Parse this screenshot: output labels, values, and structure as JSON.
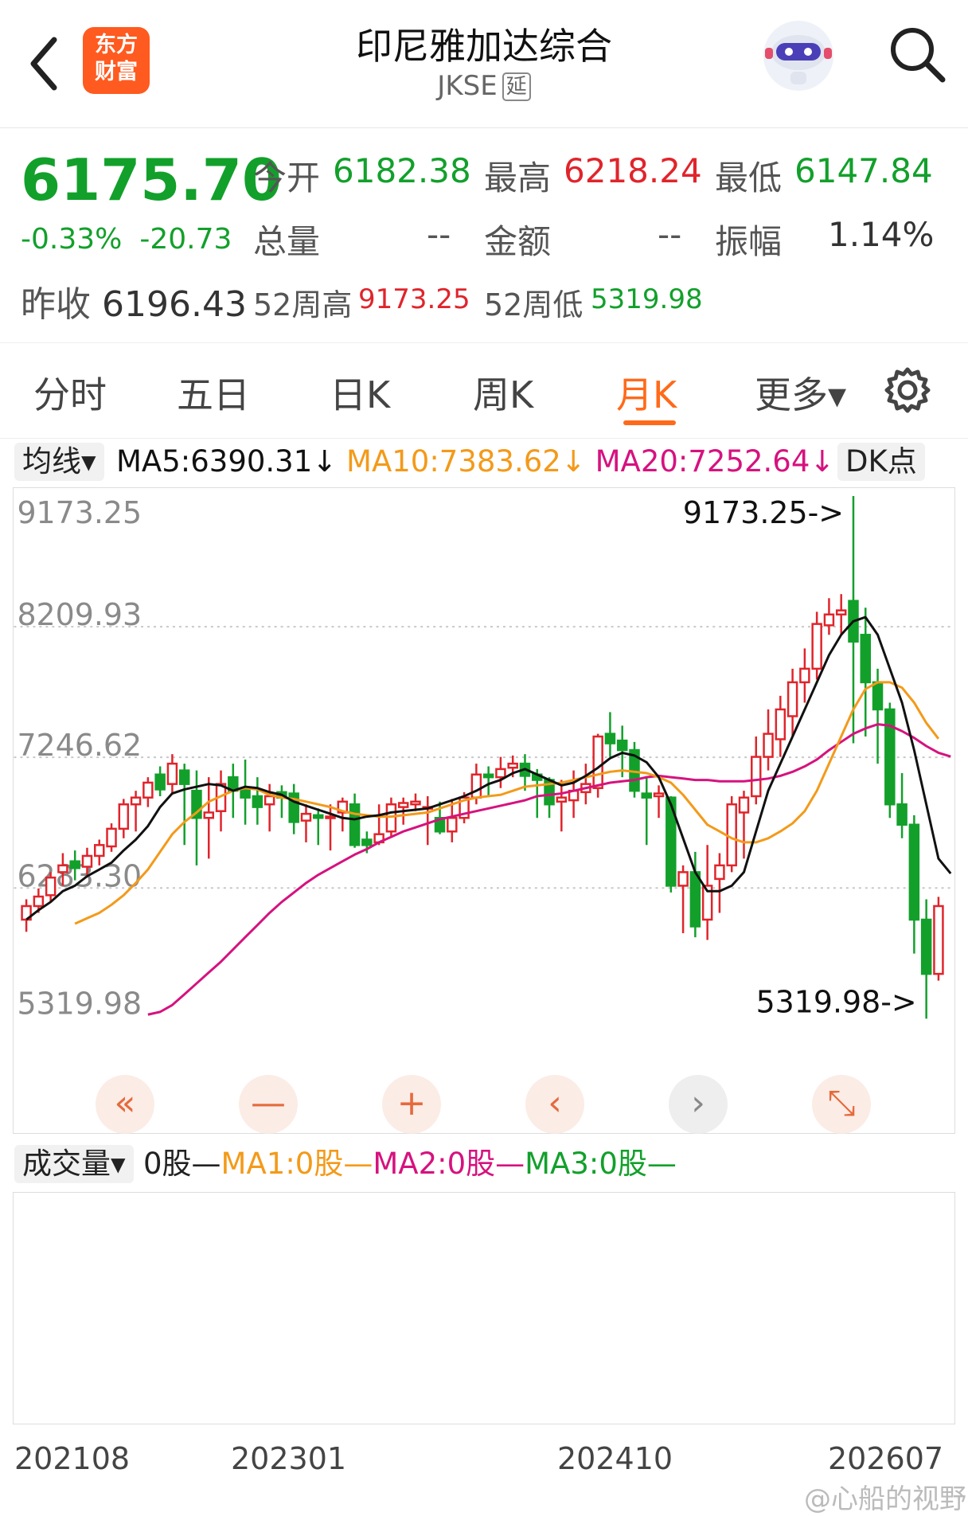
{
  "header": {
    "title": "印尼雅加达综合",
    "code": "JKSE",
    "delay_badge": "延",
    "logo_line1": "东方",
    "logo_line2": "财富"
  },
  "quote": {
    "price": "6175.70",
    "change_pct": "-0.33%",
    "change": "-20.73",
    "prev_close_label": "昨收",
    "prev_close": "6196.43",
    "open_label": "今开",
    "open": "6182.38",
    "high_label": "最高",
    "high": "6218.24",
    "low_label": "最低",
    "low": "6147.84",
    "volume_label": "总量",
    "volume": "--",
    "amount_label": "金额",
    "amount": "--",
    "amplitude_label": "振幅",
    "amplitude": "1.14%",
    "w52_high_label": "52周高",
    "w52_high": "9173.25",
    "w52_low_label": "52周低",
    "w52_low": "5319.98"
  },
  "tabs": [
    {
      "label": "分时",
      "active": false
    },
    {
      "label": "五日",
      "active": false
    },
    {
      "label": "日K",
      "active": false
    },
    {
      "label": "周K",
      "active": false
    },
    {
      "label": "月K",
      "active": true
    },
    {
      "label": "更多▾",
      "active": false
    }
  ],
  "ma_legend": {
    "selector": "均线▾",
    "ma5": "MA5:6390.31↓",
    "ma10": "MA10:7383.62↓",
    "ma20": "MA20:7252.64↓",
    "dk_button": "DK点"
  },
  "colors": {
    "up": "#e0242b",
    "down": "#12a02b",
    "ma5": "#111111",
    "ma10": "#f39a1a",
    "ma20": "#d6127e",
    "accent": "#ff6a1a"
  },
  "chart_data": {
    "type": "candlestick",
    "y_ticks": [
      "9173.25",
      "8209.93",
      "7246.62",
      "6283.30",
      "5319.98"
    ],
    "ylim": [
      5319.98,
      9173.25
    ],
    "max_label": "9173.25->",
    "min_label": "5319.98->",
    "x_labels": [
      "202108",
      "202301",
      "202410",
      "202607"
    ],
    "candles": [
      [
        6050,
        6150,
        5960,
        6200
      ],
      [
        6150,
        6220,
        6100,
        6280
      ],
      [
        6230,
        6360,
        6180,
        6400
      ],
      [
        6400,
        6450,
        6300,
        6540
      ],
      [
        6480,
        6430,
        6340,
        6560
      ],
      [
        6440,
        6520,
        6380,
        6580
      ],
      [
        6520,
        6600,
        6450,
        6640
      ],
      [
        6590,
        6720,
        6550,
        6760
      ],
      [
        6720,
        6900,
        6650,
        6940
      ],
      [
        6900,
        6950,
        6700,
        7000
      ],
      [
        6950,
        7060,
        6880,
        7100
      ],
      [
        7120,
        7010,
        6960,
        7180
      ],
      [
        7050,
        7200,
        6980,
        7270
      ],
      [
        7150,
        7050,
        6600,
        7200
      ],
      [
        7000,
        6800,
        6450,
        7150
      ],
      [
        6800,
        6840,
        6500,
        7100
      ],
      [
        6850,
        7050,
        6700,
        7150
      ],
      [
        7100,
        7000,
        6800,
        7200
      ],
      [
        7020,
        6950,
        6750,
        7230
      ],
      [
        6960,
        6880,
        6750,
        7100
      ],
      [
        6900,
        6960,
        6700,
        7050
      ],
      [
        6990,
        6950,
        6800,
        7040
      ],
      [
        6980,
        6770,
        6680,
        7050
      ],
      [
        6780,
        6830,
        6620,
        6900
      ],
      [
        6820,
        6800,
        6600,
        6870
      ],
      [
        6800,
        6810,
        6560,
        6900
      ],
      [
        6840,
        6920,
        6700,
        6950
      ],
      [
        6900,
        6600,
        6580,
        6980
      ],
      [
        6640,
        6600,
        6540,
        6700
      ],
      [
        6620,
        6680,
        6600,
        6900
      ],
      [
        6700,
        6900,
        6660,
        6950
      ],
      [
        6880,
        6910,
        6750,
        6950
      ],
      [
        6900,
        6920,
        6850,
        6980
      ],
      [
        6880,
        6880,
        6600,
        6960
      ],
      [
        6800,
        6700,
        6680,
        6920
      ],
      [
        6700,
        6800,
        6620,
        6940
      ],
      [
        6800,
        6950,
        6760,
        6990
      ],
      [
        6950,
        7120,
        6900,
        7200
      ],
      [
        7120,
        7100,
        6960,
        7180
      ],
      [
        7100,
        7160,
        7020,
        7250
      ],
      [
        7170,
        7200,
        7100,
        7260
      ],
      [
        7200,
        7110,
        7000,
        7270
      ],
      [
        7120,
        7080,
        6800,
        7160
      ],
      [
        7080,
        6900,
        6800,
        7100
      ],
      [
        6920,
        6950,
        6700,
        7080
      ],
      [
        6930,
        7000,
        6800,
        7150
      ],
      [
        6990,
        7050,
        6900,
        7200
      ],
      [
        7020,
        7400,
        6950,
        7420
      ],
      [
        7420,
        7350,
        7250,
        7580
      ],
      [
        7370,
        7300,
        7100,
        7480
      ],
      [
        7300,
        7000,
        6950,
        7360
      ],
      [
        6980,
        6950,
        6600,
        7100
      ],
      [
        6960,
        6980,
        6800,
        7040
      ],
      [
        6950,
        6300,
        6250,
        6960
      ],
      [
        6300,
        6400,
        5950,
        6450
      ],
      [
        6400,
        6000,
        5920,
        6550
      ],
      [
        6050,
        6300,
        5900,
        6600
      ],
      [
        6350,
        6450,
        6100,
        6540
      ],
      [
        6450,
        6900,
        6400,
        6960
      ],
      [
        6840,
        6950,
        6500,
        7000
      ],
      [
        6960,
        7250,
        6900,
        7400
      ],
      [
        7250,
        7420,
        7150,
        7600
      ],
      [
        7380,
        7600,
        7250,
        7700
      ],
      [
        7550,
        7800,
        7400,
        7900
      ],
      [
        7800,
        7900,
        7650,
        8050
      ],
      [
        7900,
        8230,
        7820,
        8320
      ],
      [
        8220,
        8300,
        8150,
        8420
      ],
      [
        8300,
        8330,
        8150,
        8450
      ],
      [
        8400,
        8100,
        7350,
        9173.25
      ],
      [
        8150,
        7800,
        7400,
        8350
      ],
      [
        7800,
        7600,
        7200,
        7900
      ],
      [
        7600,
        6900,
        6800,
        7650
      ],
      [
        6900,
        6750,
        6650,
        7130
      ],
      [
        6750,
        6050,
        5800,
        6820
      ],
      [
        6050,
        5650,
        5319.98,
        6200
      ],
      [
        5650,
        6150,
        5600,
        6218.24
      ]
    ],
    "ma5": [
      6050,
      6120,
      6180,
      6260,
      6300,
      6370,
      6420,
      6470,
      6560,
      6640,
      6740,
      6880,
      6980,
      7010,
      7030,
      7050,
      7040,
      7000,
      7030,
      7020,
      6990,
      6970,
      6920,
      6890,
      6860,
      6830,
      6800,
      6790,
      6810,
      6820,
      6840,
      6850,
      6860,
      6870,
      6900,
      6930,
      6960,
      7000,
      7050,
      7080,
      7130,
      7160,
      7120,
      7080,
      7040,
      7060,
      7110,
      7170,
      7240,
      7280,
      7260,
      7210,
      7100,
      6900,
      6650,
      6400,
      6260,
      6260,
      6300,
      6400,
      6700,
      7000,
      7200,
      7400,
      7600,
      7800,
      8000,
      8150,
      8250,
      8280,
      8150,
      7900,
      7650,
      7300,
      6900,
      6500,
      6390
    ],
    "ma10": [
      null,
      null,
      null,
      null,
      6020,
      6060,
      6100,
      6160,
      6230,
      6320,
      6420,
      6550,
      6680,
      6770,
      6840,
      6920,
      6960,
      7000,
      7020,
      7010,
      6970,
      6950,
      6940,
      6920,
      6900,
      6880,
      6850,
      6830,
      6820,
      6810,
      6810,
      6820,
      6830,
      6840,
      6870,
      6900,
      6930,
      6950,
      6960,
      6970,
      7000,
      7030,
      7040,
      7050,
      7060,
      7080,
      7100,
      7120,
      7140,
      7150,
      7140,
      7130,
      7100,
      7060,
      6970,
      6860,
      6750,
      6700,
      6650,
      6620,
      6620,
      6650,
      6700,
      6760,
      6850,
      7000,
      7200,
      7400,
      7600,
      7750,
      7800,
      7800,
      7760,
      7650,
      7500,
      7383.62
    ],
    "ma20": [
      null,
      null,
      null,
      null,
      null,
      null,
      null,
      null,
      null,
      null,
      5350,
      5370,
      5420,
      5500,
      5580,
      5660,
      5740,
      5830,
      5920,
      6010,
      6100,
      6180,
      6250,
      6320,
      6380,
      6430,
      6480,
      6530,
      6570,
      6620,
      6660,
      6700,
      6730,
      6760,
      6790,
      6810,
      6830,
      6850,
      6870,
      6890,
      6910,
      6930,
      6960,
      6970,
      6980,
      7000,
      7020,
      7040,
      7060,
      7070,
      7080,
      7100,
      7110,
      7100,
      7090,
      7080,
      7080,
      7070,
      7070,
      7070,
      7080,
      7090,
      7110,
      7140,
      7180,
      7230,
      7300,
      7360,
      7420,
      7460,
      7490,
      7480,
      7440,
      7390,
      7330,
      7280,
      7252.64
    ]
  },
  "nav_buttons": [
    "«",
    "—",
    "+",
    "‹",
    "›",
    "⤡"
  ],
  "volume": {
    "selector": "成交量▾",
    "text_main": "0股—",
    "text_ma1": "MA1:0股—",
    "text_ma2": "MA2:0股—",
    "text_ma3": "MA3:0股—"
  },
  "watermark": "@心船的视野"
}
